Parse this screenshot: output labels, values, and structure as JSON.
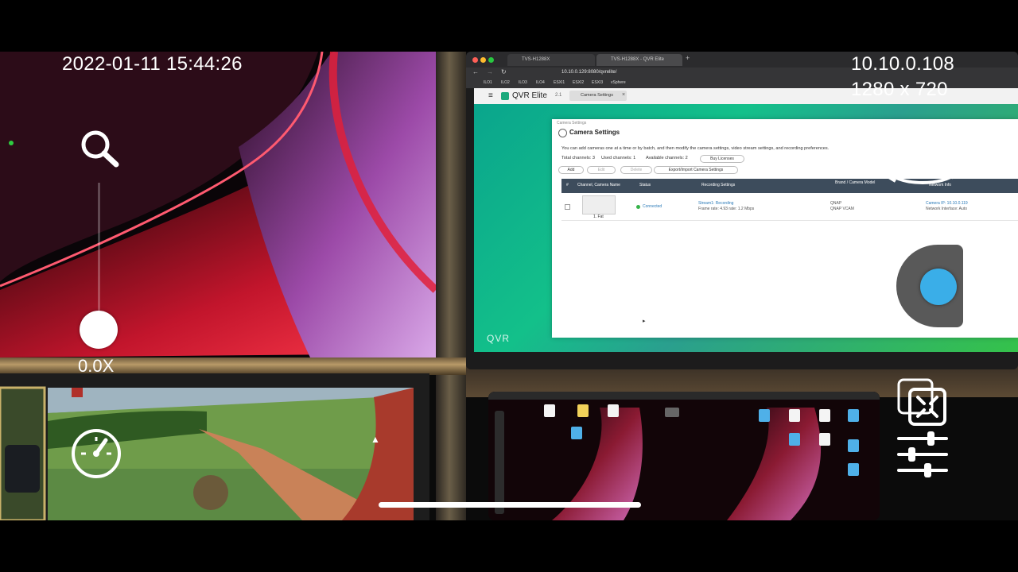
{
  "overlay": {
    "timestamp": "2022-01-11 15:44:26",
    "ip_address": "10.10.0.108",
    "resolution": "1280 x 720",
    "zoom_level": "0.0X"
  },
  "browser": {
    "tab_1": "TVS-H1288X",
    "tab_2": "TVS-H1288X - QVR Elite",
    "url": "10.10.0.129:8080/qvrelite/",
    "bookmarks": [
      "ILO1",
      "ILO2",
      "ILO3",
      "ILO4",
      "ESXI1",
      "ESXI2",
      "ESXI3",
      "vSphere"
    ]
  },
  "qvr": {
    "app_name": "QVR Elite",
    "version": "2.1",
    "tab_label": "Camera Settings",
    "brand_mark": "QVR"
  },
  "camera_settings": {
    "breadcrumb": "Camera Settings",
    "title": "Camera Settings",
    "description": "You can add cameras one at a time or by batch, and then modify the camera settings, video stream settings, and recording preferences.",
    "total_channels": "Total channels: 3",
    "used_channels": "Used channels: 1",
    "available_channels": "Available channels: 2",
    "buy_licenses": "Buy Licenses",
    "add_label": "Add",
    "edit_label": "Edit",
    "delete_label": "Delete",
    "export_import_label": "Export/Import Camera Settings",
    "columns": [
      "#",
      "Channel, Camera Name",
      "Status",
      "Recording Settings",
      "Brand / Camera Model",
      "Network Info"
    ],
    "row": {
      "camera_name": "1. Fat",
      "status": "Connected",
      "recording_line1": "Stream1: Recording",
      "recording_line2": "Frame rate: 4.93 rate: 1.2 Mbps",
      "brand": "QNAP",
      "model": "QNAP VCAM",
      "network_line1": "Camera IP: 10.10.0.119",
      "network_line2": "Network Interface: Auto"
    }
  },
  "icons": {
    "zoom": "magnifier-icon",
    "speed": "speedometer-icon",
    "ptz": "ptz-rotate-icon",
    "joystick": "joystick-icon",
    "fullscreen": "fullscreen-icon",
    "settings": "sliders-icon"
  },
  "colors": {
    "accent_blue": "#3aaee8",
    "qvr_green": "#13c08a",
    "status_green": "#36b34a",
    "table_header": "#3d4c5c"
  }
}
